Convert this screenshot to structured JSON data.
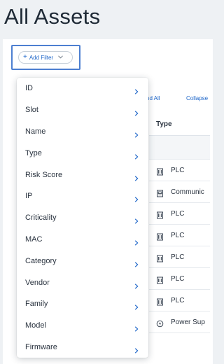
{
  "page": {
    "title": "All Assets"
  },
  "filter": {
    "add_label": "Add Filter",
    "plus_symbol": "+"
  },
  "actions": {
    "expand_all": "nd All",
    "collapse_all": "Collapse"
  },
  "table": {
    "type_header": "Type",
    "rows": [
      {
        "type": "PLC",
        "icon": "plc-icon"
      },
      {
        "type": "Communic",
        "icon": "communication-module-icon"
      },
      {
        "type": "PLC",
        "icon": "plc-icon"
      },
      {
        "type": "PLC",
        "icon": "plc-icon"
      },
      {
        "type": "PLC",
        "icon": "plc-icon"
      },
      {
        "type": "PLC",
        "icon": "plc-icon"
      },
      {
        "type": "PLC",
        "icon": "plc-icon"
      },
      {
        "type": "Power Sup",
        "icon": "power-supply-icon"
      }
    ]
  },
  "filter_menu": {
    "items": [
      {
        "label": "ID"
      },
      {
        "label": "Slot"
      },
      {
        "label": "Name"
      },
      {
        "label": "Type"
      },
      {
        "label": "Risk Score"
      },
      {
        "label": "IP"
      },
      {
        "label": "Criticality"
      },
      {
        "label": "MAC"
      },
      {
        "label": "Category"
      },
      {
        "label": "Vendor"
      },
      {
        "label": "Family"
      },
      {
        "label": "Model"
      },
      {
        "label": "Firmware"
      }
    ]
  },
  "colors": {
    "accent": "#1e66c9",
    "highlight_border": "#4d7fd1",
    "background": "#eef1f4"
  }
}
